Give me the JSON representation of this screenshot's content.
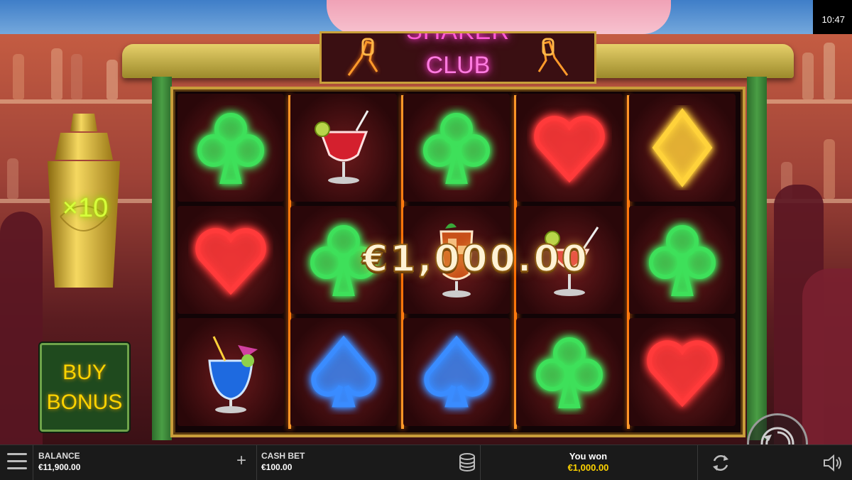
{
  "status": {
    "time": "10:47"
  },
  "game": {
    "title_top": "SHAKER",
    "title": "CLUB",
    "multiplier": "×10",
    "buy_bonus": [
      "BUY",
      "BONUS"
    ],
    "win_overlay": "€1,000.00"
  },
  "reels": [
    [
      "club-green",
      "heart-red",
      "cocktail-blue"
    ],
    [
      "cocktail-red",
      "club-green",
      "spade-blue"
    ],
    [
      "club-green",
      "cocktail-ice",
      "spade-blue"
    ],
    [
      "heart-red",
      "cocktail-lime",
      "club-green"
    ],
    [
      "diamond-yellow",
      "club-green",
      "heart-red"
    ]
  ],
  "colors": {
    "club": "#3ee05a",
    "heart": "#ff3a3a",
    "spade": "#3a8cff",
    "diamond": "#ffd23a",
    "accent_gold": "#c89d3a",
    "reel_divider": "#ff7a10"
  },
  "bottom_bar": {
    "balance_label": "BALANCE",
    "balance_value": "€11,900.00",
    "bet_label": "CASH BET",
    "bet_value": "€100.00",
    "won_label": "You won",
    "won_value": "€1,000.00"
  },
  "icons": {
    "menu": "hamburger-menu-icon",
    "plus": "plus-icon",
    "coins": "coin-stack-icon",
    "autoplay": "autoplay-icon",
    "spin": "spin-icon",
    "sound": "speaker-icon"
  }
}
